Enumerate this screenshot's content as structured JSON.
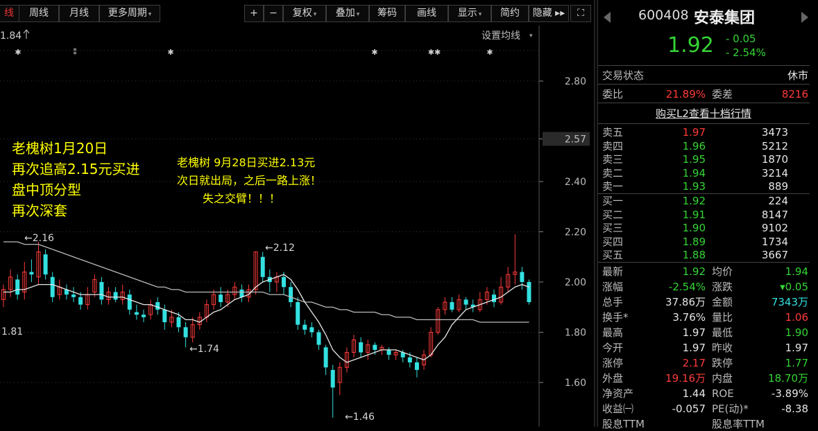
{
  "toolbar": {
    "buttons": [
      {
        "label": "线",
        "active": true
      },
      {
        "label": "周线"
      },
      {
        "label": "月线"
      },
      {
        "label": "更多周期",
        "caret": true
      },
      {
        "label": "+"
      },
      {
        "label": "−"
      },
      {
        "label": "复权",
        "caret": true
      },
      {
        "label": "叠加",
        "caret": true
      },
      {
        "label": "筹码"
      },
      {
        "label": "画线"
      },
      {
        "label": "显示",
        "caret": true
      },
      {
        "label": "简约"
      },
      {
        "label": "隐藏 ▸▸"
      },
      {
        "label": "⛶"
      }
    ]
  },
  "chart": {
    "top_value": "1.84",
    "ma_setting": "设置均线",
    "y_ticks": [
      "2.80",
      "2.57",
      "2.40",
      "2.20",
      "2.00",
      "1.80",
      "1.60"
    ],
    "y_highlight": "2.57",
    "labels": {
      "p216": "←2.16",
      "p212": "←2.12",
      "p181": "1.81",
      "p174": "←1.74",
      "p146": "←1.46"
    },
    "annotation_left": [
      "老槐树1月20日",
      "再次追高2.15元买进",
      "盘中顶分型",
      "再次深套"
    ],
    "annotation_mid": [
      "老槐树 9月28日买进2.13元",
      "次日就出局，之后一路上涨！",
      "失之交臂！！！"
    ],
    "colors": {
      "up": "#ff3b3b",
      "down": "#33e0e0",
      "ma1": "#e8e8e8",
      "ma2": "#bbbbbb",
      "annotation": "#ffff00",
      "axis": "#aaaaaa"
    }
  },
  "chart_data": {
    "type": "candlestick",
    "y_range": [
      1.46,
      2.8
    ],
    "candles": [
      [
        1.93,
        1.97,
        1.99,
        1.9
      ],
      [
        1.97,
        2.02,
        2.05,
        1.94
      ],
      [
        2.01,
        1.95,
        2.03,
        1.93
      ],
      [
        1.96,
        2.04,
        2.08,
        1.93
      ],
      [
        2.04,
        2.03,
        2.09,
        2.0
      ],
      [
        2.02,
        2.12,
        2.16,
        1.99
      ],
      [
        2.11,
        2.03,
        2.13,
        2.01
      ],
      [
        2.02,
        1.94,
        2.04,
        1.92
      ],
      [
        1.95,
        1.98,
        2.01,
        1.93
      ],
      [
        1.97,
        1.95,
        1.99,
        1.93
      ],
      [
        1.95,
        1.94,
        1.98,
        1.92
      ],
      [
        1.94,
        1.91,
        1.96,
        1.89
      ],
      [
        1.91,
        1.95,
        1.98,
        1.89
      ],
      [
        1.96,
        2.01,
        2.03,
        1.94
      ],
      [
        2.0,
        1.93,
        2.02,
        1.91
      ],
      [
        1.93,
        1.96,
        1.98,
        1.91
      ],
      [
        1.96,
        1.93,
        1.98,
        1.92
      ],
      [
        1.93,
        1.96,
        1.99,
        1.91
      ],
      [
        1.95,
        1.89,
        1.97,
        1.87
      ],
      [
        1.88,
        1.87,
        1.91,
        1.85
      ],
      [
        1.87,
        1.86,
        1.89,
        1.84
      ],
      [
        1.87,
        1.91,
        1.93,
        1.85
      ],
      [
        1.92,
        1.89,
        1.94,
        1.87
      ],
      [
        1.89,
        1.84,
        1.91,
        1.81
      ],
      [
        1.84,
        1.86,
        1.89,
        1.82
      ],
      [
        1.86,
        1.82,
        1.88,
        1.8
      ],
      [
        1.82,
        1.78,
        1.84,
        1.74
      ],
      [
        1.78,
        1.83,
        1.86,
        1.76
      ],
      [
        1.83,
        1.86,
        1.88,
        1.81
      ],
      [
        1.86,
        1.91,
        1.93,
        1.84
      ],
      [
        1.91,
        1.95,
        1.97,
        1.89
      ],
      [
        1.95,
        1.92,
        1.98,
        1.9
      ],
      [
        1.92,
        1.95,
        1.97,
        1.9
      ],
      [
        1.95,
        1.98,
        2.0,
        1.93
      ],
      [
        1.97,
        1.94,
        1.99,
        1.92
      ],
      [
        1.94,
        1.97,
        1.99,
        1.92
      ],
      [
        1.97,
        2.12,
        2.12,
        1.95
      ],
      [
        2.1,
        2.02,
        2.12,
        2.0
      ],
      [
        2.02,
        2.0,
        2.05,
        1.96
      ],
      [
        2.0,
        2.02,
        2.04,
        1.96
      ],
      [
        2.02,
        1.98,
        2.04,
        1.95
      ],
      [
        1.98,
        1.92,
        2.0,
        1.9
      ],
      [
        1.92,
        1.83,
        1.94,
        1.81
      ],
      [
        1.83,
        1.81,
        1.85,
        1.79
      ],
      [
        1.82,
        1.8,
        1.84,
        1.78
      ],
      [
        1.8,
        1.75,
        1.81,
        1.73
      ],
      [
        1.74,
        1.66,
        1.75,
        1.63
      ],
      [
        1.65,
        1.58,
        1.67,
        1.46
      ],
      [
        1.6,
        1.66,
        1.68,
        1.55
      ],
      [
        1.66,
        1.72,
        1.74,
        1.64
      ],
      [
        1.72,
        1.77,
        1.79,
        1.7
      ],
      [
        1.76,
        1.72,
        1.78,
        1.7
      ],
      [
        1.72,
        1.75,
        1.77,
        1.69
      ],
      [
        1.75,
        1.73,
        1.76,
        1.71
      ],
      [
        1.73,
        1.74,
        1.75,
        1.71
      ],
      [
        1.73,
        1.71,
        1.74,
        1.69
      ],
      [
        1.71,
        1.72,
        1.73,
        1.69
      ],
      [
        1.72,
        1.7,
        1.73,
        1.68
      ],
      [
        1.7,
        1.68,
        1.72,
        1.66
      ],
      [
        1.68,
        1.65,
        1.7,
        1.62
      ],
      [
        1.67,
        1.71,
        1.73,
        1.65
      ],
      [
        1.71,
        1.8,
        1.82,
        1.7
      ],
      [
        1.8,
        1.89,
        1.9,
        1.79
      ],
      [
        1.89,
        1.92,
        1.94,
        1.87
      ],
      [
        1.92,
        1.89,
        1.94,
        1.88
      ],
      [
        1.89,
        1.93,
        1.95,
        1.88
      ],
      [
        1.93,
        1.91,
        1.94,
        1.89
      ],
      [
        1.91,
        1.9,
        1.93,
        1.88
      ],
      [
        1.89,
        1.93,
        1.96,
        1.88
      ],
      [
        1.93,
        1.96,
        1.98,
        1.91
      ],
      [
        1.95,
        1.92,
        1.97,
        1.9
      ],
      [
        1.92,
        1.98,
        2.02,
        1.91
      ],
      [
        1.98,
        2.03,
        2.06,
        1.96
      ],
      [
        2.03,
        2.04,
        2.19,
        1.99
      ],
      [
        2.04,
        2.0,
        2.06,
        1.97
      ],
      [
        2.0,
        1.92,
        2.01,
        1.91
      ]
    ],
    "ma_fast": [
      1.96,
      1.96,
      1.97,
      1.97,
      1.98,
      1.99,
      1.99,
      1.99,
      1.98,
      1.97,
      1.96,
      1.95,
      1.95,
      1.95,
      1.95,
      1.94,
      1.94,
      1.94,
      1.93,
      1.92,
      1.91,
      1.91,
      1.9,
      1.89,
      1.88,
      1.87,
      1.85,
      1.85,
      1.84,
      1.86,
      1.88,
      1.89,
      1.91,
      1.93,
      1.94,
      1.95,
      1.98,
      2.0,
      2.01,
      2.02,
      2.03,
      2.01,
      1.97,
      1.92,
      1.88,
      1.84,
      1.79,
      1.73,
      1.7,
      1.68,
      1.69,
      1.7,
      1.71,
      1.72,
      1.73,
      1.73,
      1.73,
      1.72,
      1.71,
      1.7,
      1.69,
      1.71,
      1.75,
      1.78,
      1.83,
      1.86,
      1.89,
      1.9,
      1.91,
      1.92,
      1.93,
      1.94,
      1.96,
      1.98,
      1.99,
      1.98
    ],
    "ma_slow": [
      2.16,
      2.16,
      2.16,
      2.15,
      2.15,
      2.15,
      2.14,
      2.13,
      2.12,
      2.11,
      2.1,
      2.09,
      2.08,
      2.07,
      2.06,
      2.05,
      2.04,
      2.03,
      2.02,
      2.01,
      2.0,
      1.99,
      1.98,
      1.98,
      1.97,
      1.97,
      1.96,
      1.96,
      1.96,
      1.96,
      1.96,
      1.96,
      1.96,
      1.96,
      1.96,
      1.96,
      1.96,
      1.96,
      1.95,
      1.95,
      1.95,
      1.94,
      1.93,
      1.92,
      1.92,
      1.91,
      1.9,
      1.9,
      1.89,
      1.89,
      1.88,
      1.88,
      1.88,
      1.88,
      1.87,
      1.87,
      1.86,
      1.86,
      1.86,
      1.85,
      1.85,
      1.85,
      1.85,
      1.85,
      1.85,
      1.85,
      1.85,
      1.85,
      1.84,
      1.84,
      1.84,
      1.84,
      1.84,
      1.84,
      1.84,
      1.84
    ]
  },
  "quote": {
    "code": "600408",
    "name": "安泰集团",
    "price": "1.92",
    "change": "- 0.05",
    "change_pct": "- 2.54%",
    "status_label": "交易状态",
    "status_value": "休市",
    "weibi_label": "委比",
    "weibi_value": "21.89%",
    "weicha_label": "委差",
    "weicha_value": "8216",
    "l2_link": "购买L2查看十档行情",
    "asks": [
      {
        "label": "卖五",
        "price": "1.97",
        "vol": "3473",
        "pc": "red"
      },
      {
        "label": "卖四",
        "price": "1.96",
        "vol": "5212",
        "pc": "green"
      },
      {
        "label": "卖三",
        "price": "1.95",
        "vol": "1870",
        "pc": "green"
      },
      {
        "label": "卖二",
        "price": "1.94",
        "vol": "3214",
        "pc": "green"
      },
      {
        "label": "卖一",
        "price": "1.93",
        "vol": "889",
        "pc": "green"
      }
    ],
    "bids": [
      {
        "label": "买一",
        "price": "1.92",
        "vol": "224",
        "pc": "green"
      },
      {
        "label": "买二",
        "price": "1.91",
        "vol": "8147",
        "pc": "green"
      },
      {
        "label": "买三",
        "price": "1.90",
        "vol": "9102",
        "pc": "green"
      },
      {
        "label": "买四",
        "price": "1.89",
        "vol": "1734",
        "pc": "green"
      },
      {
        "label": "买五",
        "price": "1.88",
        "vol": "3667",
        "pc": "green"
      }
    ],
    "stats": [
      [
        {
          "l": "最新",
          "v": "1.92",
          "c": "green"
        },
        {
          "l": "均价",
          "v": "1.94",
          "c": "green"
        }
      ],
      [
        {
          "l": "涨幅",
          "v": "-2.54%",
          "c": "green"
        },
        {
          "l": "涨跌",
          "v": "▾0.05",
          "c": "green"
        }
      ],
      [
        {
          "l": "总手",
          "v": "37.86万",
          "c": "white"
        },
        {
          "l": "金额",
          "v": "7343万",
          "c": "cyan"
        }
      ],
      [
        {
          "l": "换手*",
          "v": "3.76%",
          "c": "white"
        },
        {
          "l": "量比",
          "v": "1.06",
          "c": "red"
        }
      ],
      [
        {
          "l": "最高",
          "v": "1.97",
          "c": "white"
        },
        {
          "l": "最低",
          "v": "1.90",
          "c": "green"
        }
      ],
      [
        {
          "l": "今开",
          "v": "1.97",
          "c": "white"
        },
        {
          "l": "昨收",
          "v": "1.97",
          "c": "white"
        }
      ],
      [
        {
          "l": "涨停",
          "v": "2.17",
          "c": "red"
        },
        {
          "l": "跌停",
          "v": "1.77",
          "c": "green"
        }
      ],
      [
        {
          "l": "外盘",
          "v": "19.16万",
          "c": "red"
        },
        {
          "l": "内盘",
          "v": "18.70万",
          "c": "green"
        }
      ],
      [
        {
          "l": "净资产",
          "v": "1.44",
          "c": "white"
        },
        {
          "l": "ROE",
          "v": "-3.89%",
          "c": "white"
        }
      ],
      [
        {
          "l": "收益㈠",
          "v": "-0.057",
          "c": "white"
        },
        {
          "l": "PE(动)*",
          "v": "-8.38",
          "c": "white"
        }
      ],
      [
        {
          "l": "股息TTM",
          "v": "",
          "c": "white"
        },
        {
          "l": "股息率TTM",
          "v": "",
          "c": "white"
        }
      ]
    ]
  }
}
